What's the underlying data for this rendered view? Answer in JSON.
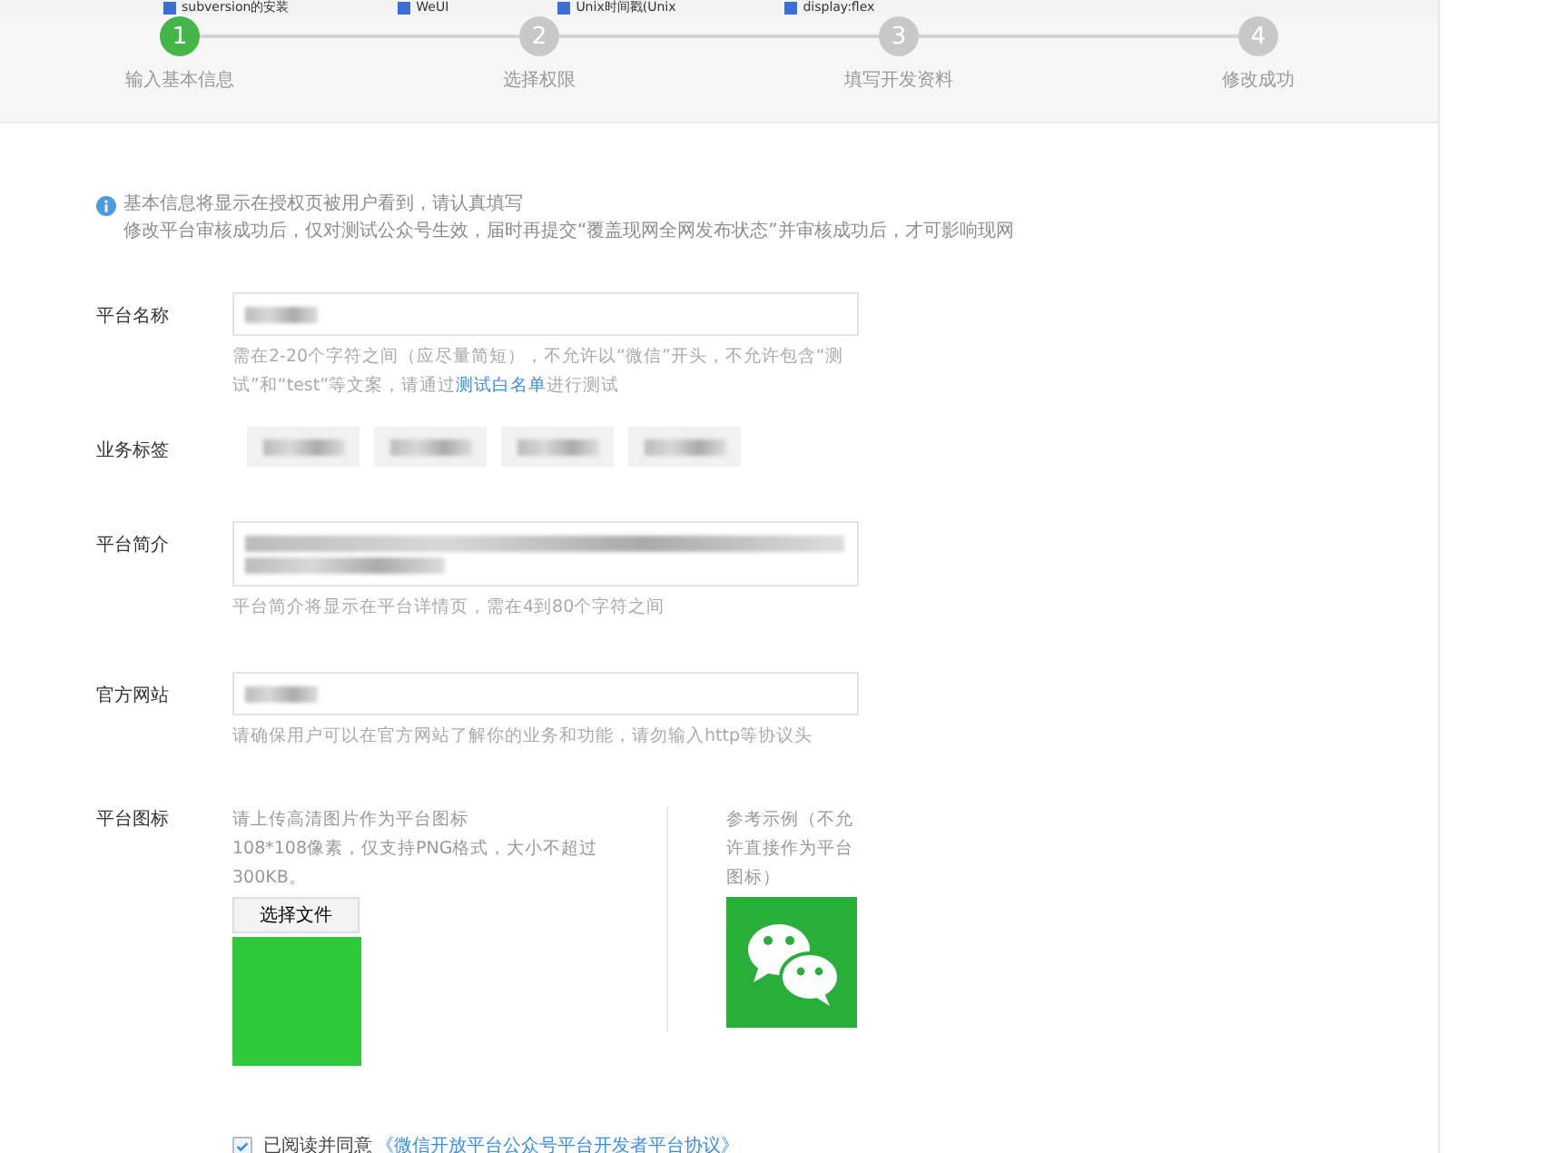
{
  "bookmarks": [
    {
      "label": "subversion的安装"
    },
    {
      "label": "WeUI"
    },
    {
      "label": "Unix时间戳(Unix"
    },
    {
      "label": "display:flex"
    }
  ],
  "steps": [
    {
      "number": "1",
      "label": "输入基本信息",
      "selected": true
    },
    {
      "number": "2",
      "label": "选择权限",
      "selected": false
    },
    {
      "number": "3",
      "label": "填写开发资料",
      "selected": false
    },
    {
      "number": "4",
      "label": "修改成功",
      "selected": false
    }
  ],
  "notice": {
    "lines": [
      "基本信息将显示在授权页被用户看到，请认真填写",
      "修改平台审核成功后，仅对测试公众号生效，届时再提交“覆盖现网全网发布状态”并审核成功后，才可影响现网"
    ]
  },
  "form": [
    {
      "kind": "text",
      "label": "平台名称",
      "hint": "需在2-20个字符之间（应尽量简短），不允许以“微信”开头，不允许包含“测试”和“test”等文案，请通过**测试白名单**进行测试"
    },
    {
      "kind": "tags",
      "label": "业务标签"
    },
    {
      "kind": "textarea",
      "label": "平台简介",
      "hint": "平台简介将显示在平台详情页，需在4到80个字符之间"
    },
    {
      "kind": "text",
      "label": "官方网站",
      "hint": "请确保用户可以在官方网站了解你的业务和功能，请勿输入http等协议头"
    },
    {
      "kind": "icon",
      "label": "平台图标",
      "hint": "请上传高清图片作为平台图标\n108*108像素，仅支持PNG格式，大小不超过300KB。",
      "button": "选择文件",
      "example": "参考示例（不允许直接作为平台图标）"
    }
  ],
  "agreement": {
    "checked": true,
    "label": "已阅读并同意",
    "link": "《微信开放平台公众号平台开发者平台协议》"
  }
}
